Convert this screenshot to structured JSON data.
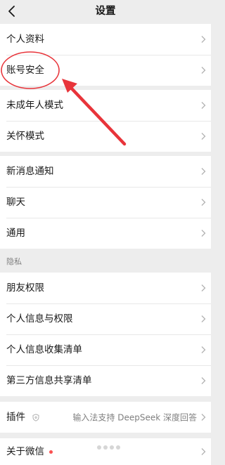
{
  "header": {
    "title": "设置",
    "back_icon": "chevron-left-icon"
  },
  "groups": {
    "account": {
      "personal_info": "个人资料",
      "account_security": "账号安全"
    },
    "modes": {
      "minor_mode": "未成年人模式",
      "care_mode": "关怀模式"
    },
    "general": {
      "notifications": "新消息通知",
      "chat": "聊天",
      "general": "通用"
    },
    "privacy": {
      "section_title": "隐私",
      "friend_permissions": "朋友权限",
      "personal_info_permissions": "个人信息与权限",
      "personal_info_collection": "个人信息收集清单",
      "third_party_sharing": "第三方信息共享清单"
    },
    "plugins": {
      "label": "插件",
      "value": "输入法支持 DeepSeek 深度回答"
    },
    "about": {
      "label": "关于微信"
    }
  },
  "annotation": {
    "circle_color": "#e8343a",
    "arrow_color": "#e8343a"
  },
  "colors": {
    "background": "#ededed",
    "card": "#ffffff",
    "text": "#191919",
    "secondary_text": "#7f7f7f",
    "badge": "#fa5151"
  }
}
